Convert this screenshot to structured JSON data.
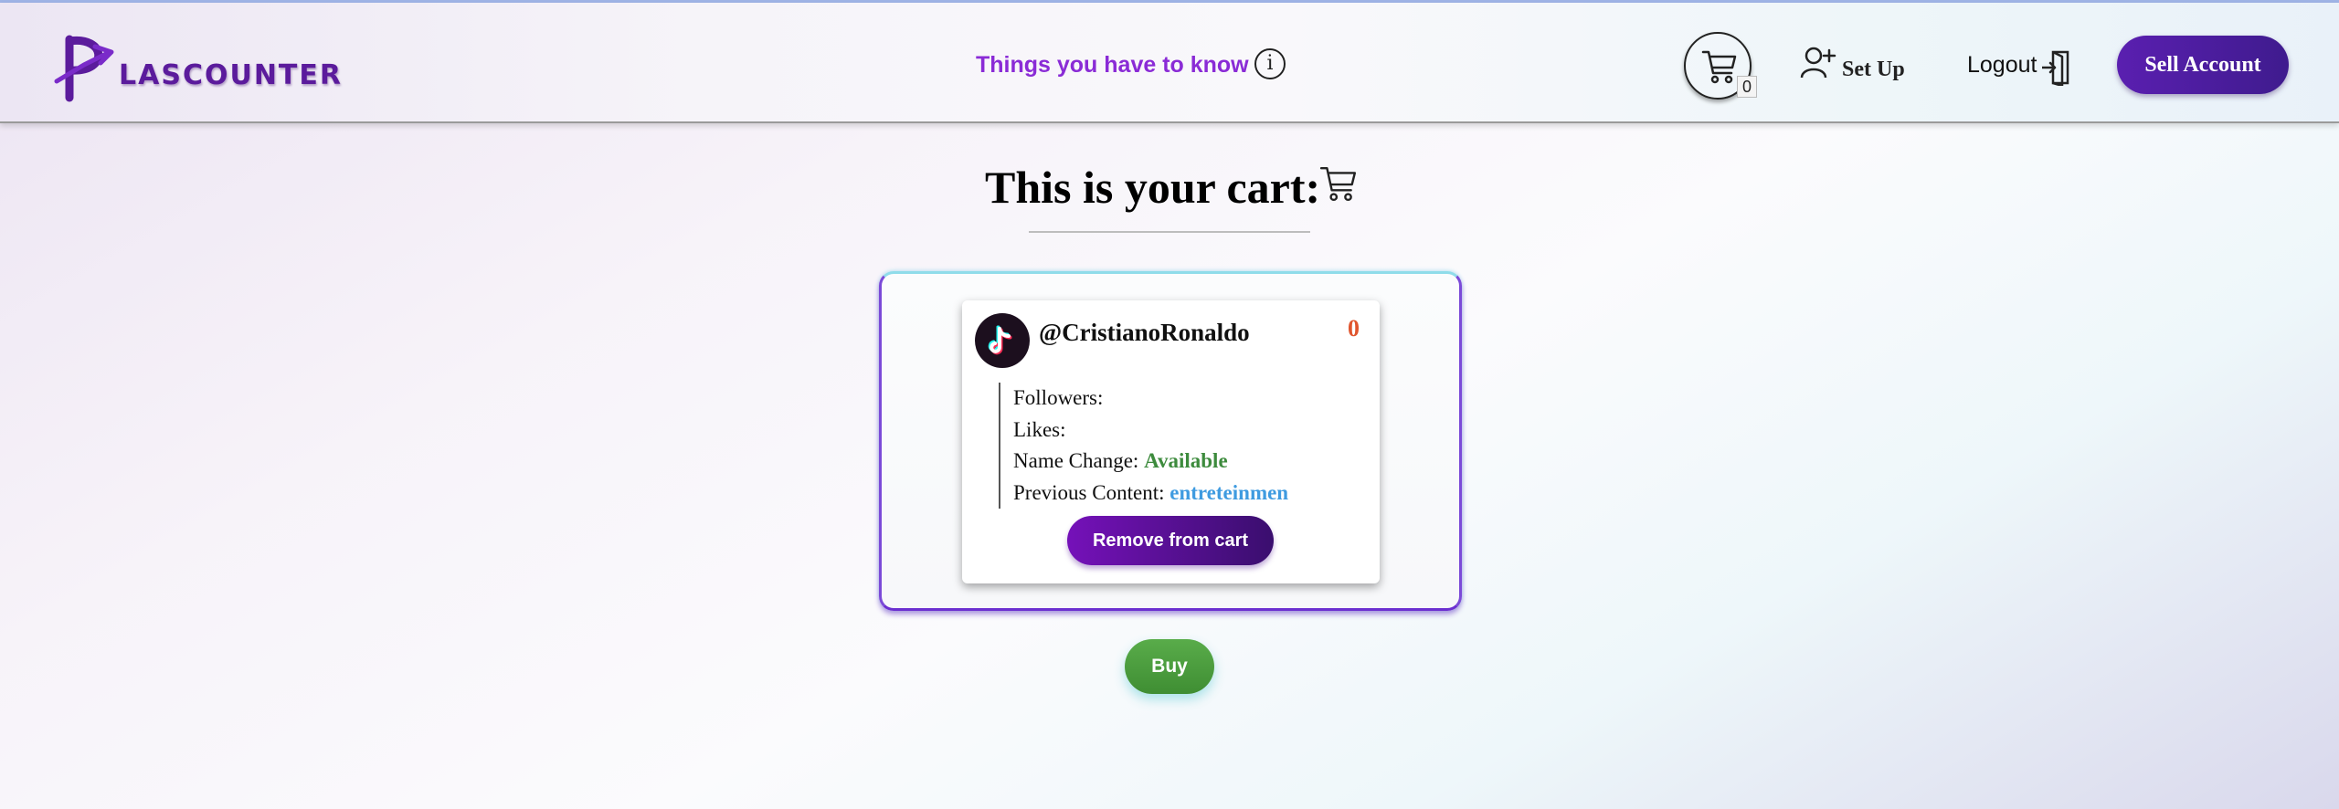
{
  "header": {
    "logo": {
      "initial": "P",
      "text": "LASCOUNTER",
      "brand_color": "#5b1b9c"
    },
    "info_link": "Things you have to know",
    "info_icon": "i",
    "cart": {
      "icon": "cart-icon",
      "count": "0"
    },
    "setup_label": "Set Up",
    "logout_label": "Logout",
    "sell_label": "Sell Account"
  },
  "main": {
    "title": "This is your cart:",
    "cart_items": [
      {
        "platform_icon": "tiktok-icon",
        "handle": "@CristianoRonaldo",
        "price": "0",
        "details": {
          "followers_label": "Followers:",
          "followers_value": "",
          "likes_label": "Likes:",
          "likes_value": "",
          "name_change_label": "Name Change:",
          "name_change_value": "Available",
          "previous_content_label": "Previous Content:",
          "previous_content_value": "entreteinmen"
        },
        "remove_label": "Remove from cart"
      }
    ],
    "buy_label": "Buy"
  },
  "colors": {
    "accent_purple": "#5a1fb0",
    "remove_purple": "#7511b9",
    "buy_green": "#4a9d3e",
    "price_orange": "#e0552e",
    "available_green": "#3d8b3d",
    "content_blue": "#3f9be0"
  }
}
